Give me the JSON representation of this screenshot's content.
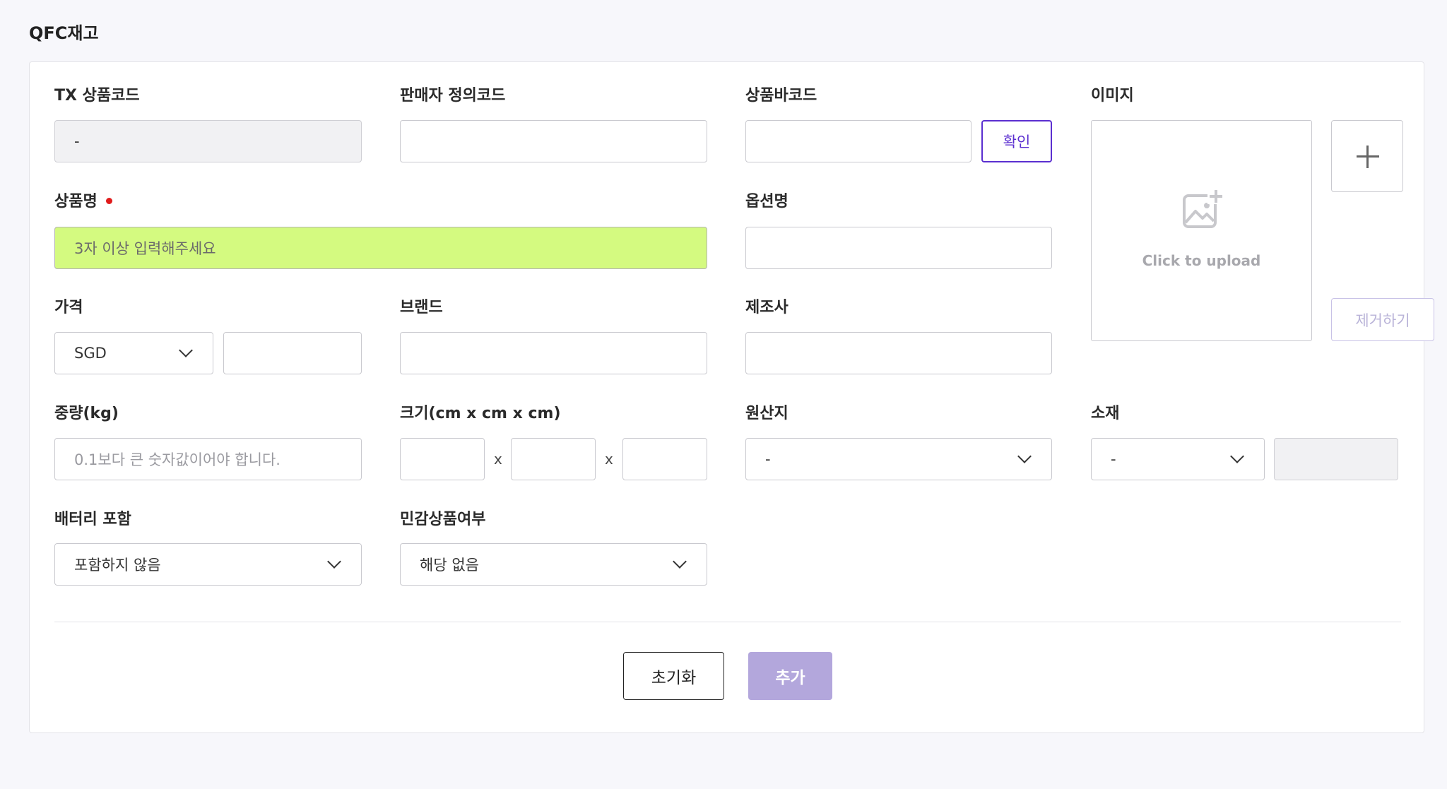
{
  "page": {
    "title": "QFC재고"
  },
  "form": {
    "tx_code": {
      "label": "TX 상품코드",
      "value": "-"
    },
    "seller_code": {
      "label": "판매자 정의코드",
      "value": ""
    },
    "barcode": {
      "label": "상품바코드",
      "value": "",
      "confirm_label": "확인"
    },
    "image": {
      "label": "이미지",
      "upload_text": "Click to upload",
      "remove_label": "제거하기",
      "icon": "image-plus-icon"
    },
    "product_name": {
      "label": "상품명",
      "placeholder": "3자 이상 입력해주세요",
      "required": true,
      "highlight_color": "#d4fa80"
    },
    "option_name": {
      "label": "옵션명",
      "value": ""
    },
    "price": {
      "label": "가격",
      "currency": "SGD",
      "value": ""
    },
    "brand": {
      "label": "브랜드",
      "value": ""
    },
    "manufacturer": {
      "label": "제조사",
      "value": ""
    },
    "weight": {
      "label": "중량(kg)",
      "placeholder": "0.1보다 큰 숫자값이어야 합니다."
    },
    "size": {
      "label": "크기(cm x cm x cm)",
      "separator": "x"
    },
    "origin": {
      "label": "원산지",
      "value": "-"
    },
    "material": {
      "label": "소재",
      "value": "-",
      "extra_value": ""
    },
    "battery": {
      "label": "배터리 포함",
      "value": "포함하지 않음"
    },
    "sensitive": {
      "label": "민감상품여부",
      "value": "해당 없음"
    }
  },
  "actions": {
    "reset_label": "초기화",
    "add_label": "추가",
    "accent_color": "#5b2fd0",
    "add_color": "#b3a7dc"
  }
}
